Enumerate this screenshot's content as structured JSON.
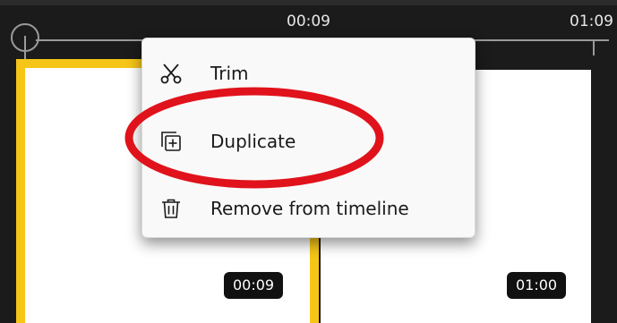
{
  "timeline": {
    "ruler": {
      "time_markers": [
        "00:09",
        "01:09"
      ]
    },
    "clips": [
      {
        "duration": "00:09",
        "selected": true
      },
      {
        "duration": "01:00",
        "selected": false
      }
    ],
    "colors": {
      "background": "#1b1b1b",
      "selection_border": "#f5c518",
      "highlight_ellipse": "#e0121b"
    }
  },
  "context_menu": {
    "items": [
      {
        "label": "Trim",
        "icon": "scissors-icon"
      },
      {
        "label": "Duplicate",
        "icon": "duplicate-icon"
      },
      {
        "label": "Remove from timeline",
        "icon": "trash-icon"
      }
    ]
  }
}
